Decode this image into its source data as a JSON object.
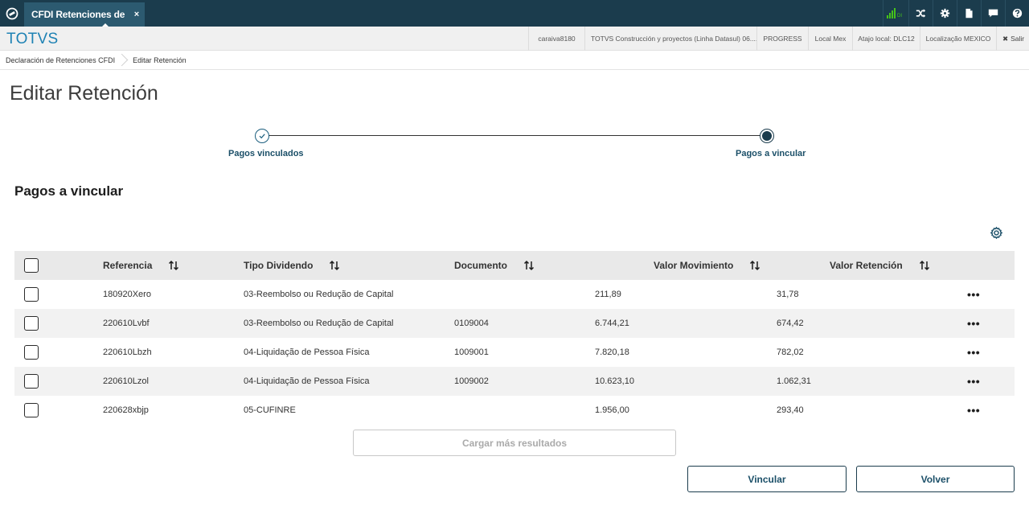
{
  "topbar": {
    "tab_label": "CFDI Retenciones de",
    "tab_close": "×",
    "di_label": "DI"
  },
  "header": {
    "brand": "TOTVS",
    "info": [
      "caraiva8180",
      "TOTVS Construcción y proyectos (Linha Datasul) 06....",
      "PROGRESS",
      "Local Mex",
      "Atajo local: DLC12",
      "Localização MEXICO"
    ],
    "logout_icon": "✖",
    "logout_label": "Salir"
  },
  "breadcrumb": {
    "items": [
      "Declaración de Retenciones CFDI",
      "Editar Retención"
    ]
  },
  "page": {
    "title": "Editar Retención",
    "section_title": "Pagos a vincular"
  },
  "stepper": {
    "steps": [
      "Pagos vinculados",
      "Pagos a vincular"
    ]
  },
  "table": {
    "columns": [
      "Referencia",
      "Tipo Dividendo",
      "Documento",
      "Valor Movimiento",
      "Valor Retención"
    ],
    "rows": [
      {
        "referencia": "180920Xero",
        "tipo": "03-Reembolso ou Redução de Capital",
        "documento": "",
        "valor_mov": "211,89",
        "valor_ret": "31,78"
      },
      {
        "referencia": "220610Lvbf",
        "tipo": "03-Reembolso ou Redução de Capital",
        "documento": "0109004",
        "valor_mov": "6.744,21",
        "valor_ret": "674,42"
      },
      {
        "referencia": "220610Lbzh",
        "tipo": "04-Liquidação de Pessoa Física",
        "documento": "1009001",
        "valor_mov": "7.820,18",
        "valor_ret": "782,02"
      },
      {
        "referencia": "220610Lzol",
        "tipo": "04-Liquidação de Pessoa Física",
        "documento": "1009002",
        "valor_mov": "10.623,10",
        "valor_ret": "1.062,31"
      },
      {
        "referencia": "220628xbjp",
        "tipo": "05-CUFINRE",
        "documento": "",
        "valor_mov": "1.956,00",
        "valor_ret": "293,40"
      }
    ],
    "row_actions": "•••"
  },
  "actions": {
    "load_more": "Cargar más resultados",
    "vincular": "Vincular",
    "volver": "Volver"
  },
  "colors": {
    "topbar": "#1b3c4d",
    "tab_active": "#2c5a70",
    "brand": "#1e82b4",
    "accent": "#1b4f68",
    "signal": "#45c21a"
  }
}
